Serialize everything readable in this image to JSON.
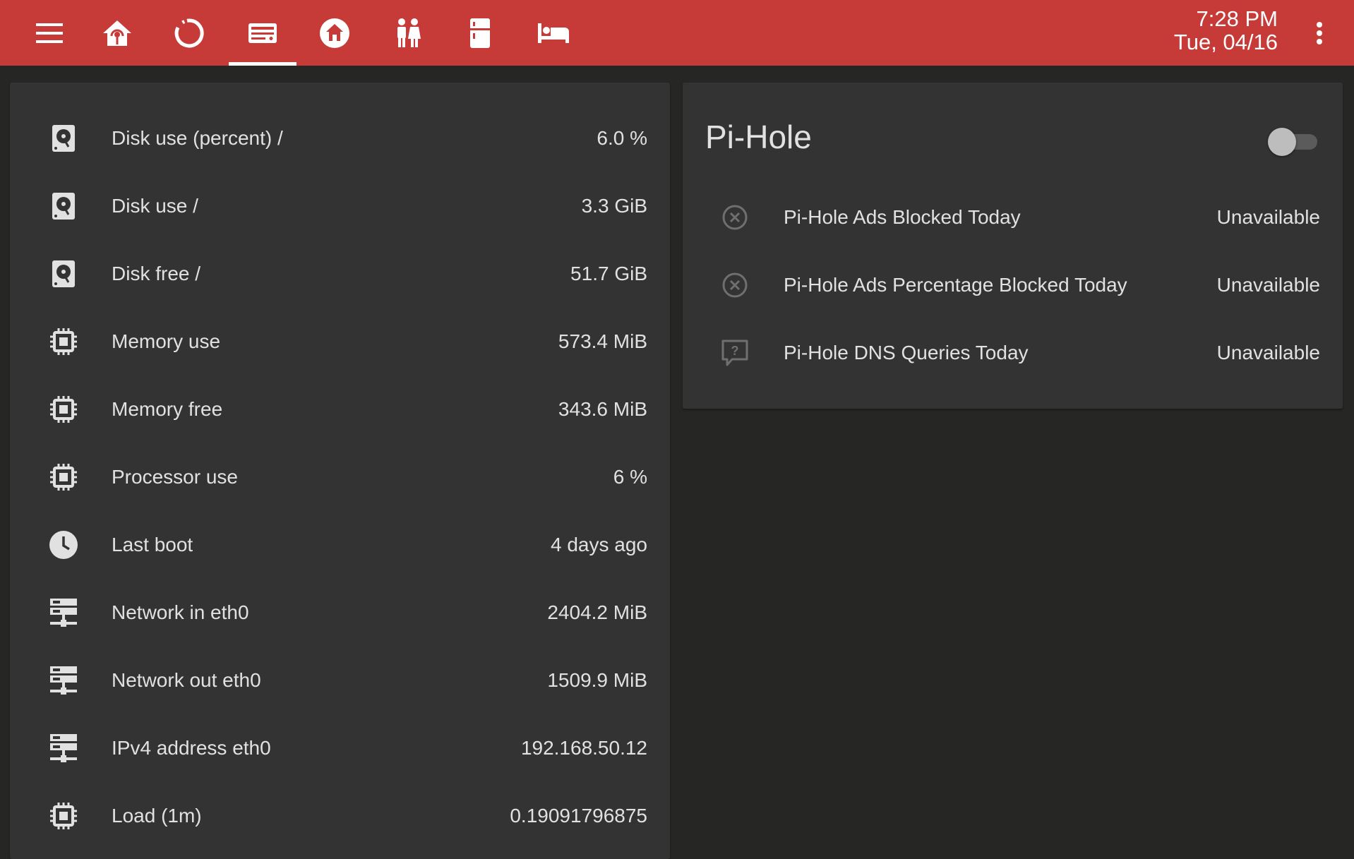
{
  "header": {
    "time": "7:28 PM",
    "date": "Tue, 04/16",
    "tabs": [
      {
        "icon": "home-automation-icon"
      },
      {
        "icon": "refresh-circle-icon"
      },
      {
        "icon": "server-icon",
        "active": true
      },
      {
        "icon": "home-icon"
      },
      {
        "icon": "people-icon"
      },
      {
        "icon": "fridge-icon"
      },
      {
        "icon": "bed-icon"
      }
    ],
    "colors": {
      "bar": "#c63b38",
      "indicator": "#ffffff"
    }
  },
  "system_card": {
    "rows": [
      {
        "icon": "harddisk-icon",
        "label": "Disk use (percent) /",
        "value": "6.0 %"
      },
      {
        "icon": "harddisk-icon",
        "label": "Disk use /",
        "value": "3.3 GiB"
      },
      {
        "icon": "harddisk-icon",
        "label": "Disk free /",
        "value": "51.7 GiB"
      },
      {
        "icon": "chip-icon",
        "label": "Memory use",
        "value": "573.4 MiB"
      },
      {
        "icon": "chip-icon",
        "label": "Memory free",
        "value": "343.6 MiB"
      },
      {
        "icon": "chip-icon",
        "label": "Processor use",
        "value": "6 %"
      },
      {
        "icon": "clock-icon",
        "label": "Last boot",
        "value": "4 days ago"
      },
      {
        "icon": "server-network-icon",
        "label": "Network in eth0",
        "value": "2404.2 MiB"
      },
      {
        "icon": "server-network-icon",
        "label": "Network out eth0",
        "value": "1509.9 MiB"
      },
      {
        "icon": "server-network-icon",
        "label": "IPv4 address eth0",
        "value": "192.168.50.12"
      },
      {
        "icon": "chip-icon",
        "label": "Load (1m)",
        "value": "0.19091796875"
      }
    ]
  },
  "pihole_card": {
    "title": "Pi-Hole",
    "toggle_on": false,
    "rows": [
      {
        "icon": "close-circle-outline-icon",
        "label": "Pi-Hole Ads Blocked Today",
        "value": "Unavailable"
      },
      {
        "icon": "close-circle-outline-icon",
        "label": "Pi-Hole Ads Percentage Blocked Today",
        "value": "Unavailable"
      },
      {
        "icon": "comment-question-outline-icon",
        "label": "Pi-Hole DNS Queries Today",
        "value": "Unavailable"
      }
    ]
  }
}
